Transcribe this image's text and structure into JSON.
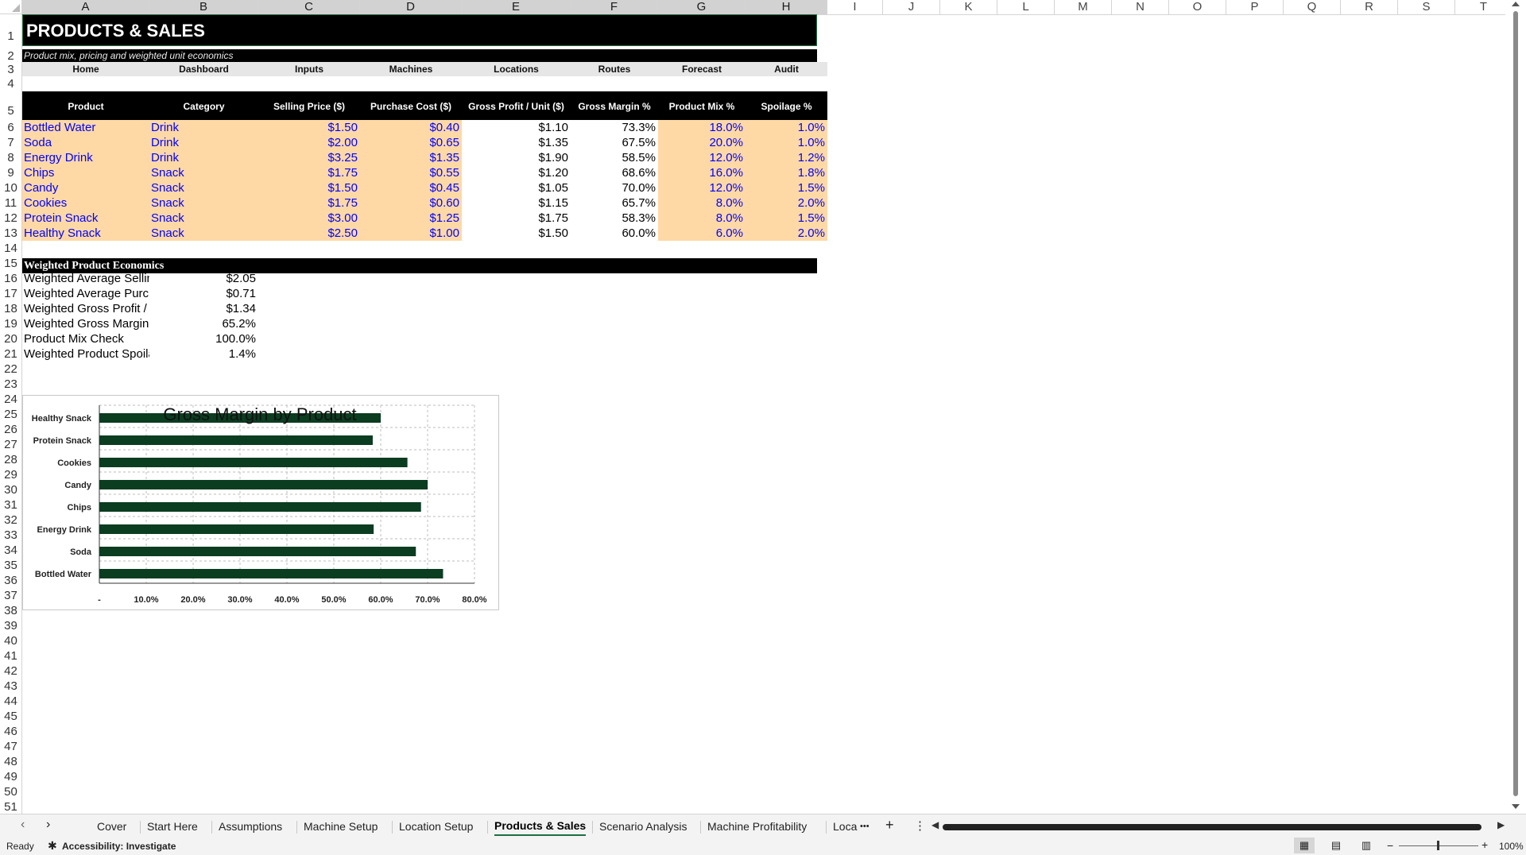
{
  "columns": [
    "A",
    "B",
    "C",
    "D",
    "E",
    "F",
    "G",
    "H",
    "I",
    "J",
    "K",
    "L",
    "M",
    "N",
    "O",
    "P",
    "Q",
    "R",
    "S",
    "T"
  ],
  "rows": [
    "1",
    "2",
    "3",
    "4",
    "5",
    "6",
    "7",
    "8",
    "9",
    "10",
    "11",
    "12",
    "13",
    "14",
    "15",
    "16",
    "17",
    "18",
    "19",
    "20",
    "21",
    "22",
    "23",
    "24",
    "25",
    "26",
    "27",
    "28",
    "29",
    "30",
    "31",
    "32",
    "33",
    "34",
    "35",
    "36",
    "37",
    "38",
    "39",
    "40",
    "41",
    "42",
    "43",
    "44",
    "45",
    "46",
    "47",
    "48",
    "49",
    "50",
    "51"
  ],
  "sheet": {
    "title": "PRODUCTS & SALES",
    "subtitle": "Product mix, pricing and weighted unit economics",
    "nav": [
      "Home",
      "Dashboard",
      "Inputs",
      "Machines",
      "Locations",
      "Routes",
      "Forecast",
      "Audit"
    ],
    "headers": [
      "Product",
      "Category",
      "Selling Price ($)",
      "Purchase Cost ($)",
      "Gross Profit / Unit ($)",
      "Gross Margin %",
      "Product Mix %",
      "Spoilage %"
    ],
    "products": [
      {
        "product": "Bottled Water",
        "category": "Drink",
        "price": "$1.50",
        "cost": "$0.40",
        "profit": "$1.10",
        "margin": "73.3%",
        "mix": "18.0%",
        "spoilage": "1.0%"
      },
      {
        "product": "Soda",
        "category": "Drink",
        "price": "$2.00",
        "cost": "$0.65",
        "profit": "$1.35",
        "margin": "67.5%",
        "mix": "20.0%",
        "spoilage": "1.0%"
      },
      {
        "product": "Energy Drink",
        "category": "Drink",
        "price": "$3.25",
        "cost": "$1.35",
        "profit": "$1.90",
        "margin": "58.5%",
        "mix": "12.0%",
        "spoilage": "1.2%"
      },
      {
        "product": "Chips",
        "category": "Snack",
        "price": "$1.75",
        "cost": "$0.55",
        "profit": "$1.20",
        "margin": "68.6%",
        "mix": "16.0%",
        "spoilage": "1.8%"
      },
      {
        "product": "Candy",
        "category": "Snack",
        "price": "$1.50",
        "cost": "$0.45",
        "profit": "$1.05",
        "margin": "70.0%",
        "mix": "12.0%",
        "spoilage": "1.5%"
      },
      {
        "product": "Cookies",
        "category": "Snack",
        "price": "$1.75",
        "cost": "$0.60",
        "profit": "$1.15",
        "margin": "65.7%",
        "mix": "8.0%",
        "spoilage": "2.0%"
      },
      {
        "product": "Protein Snack",
        "category": "Snack",
        "price": "$3.00",
        "cost": "$1.25",
        "profit": "$1.75",
        "margin": "58.3%",
        "mix": "8.0%",
        "spoilage": "1.5%"
      },
      {
        "product": "Healthy Snack",
        "category": "Snack",
        "price": "$2.50",
        "cost": "$1.00",
        "profit": "$1.50",
        "margin": "60.0%",
        "mix": "6.0%",
        "spoilage": "2.0%"
      }
    ],
    "weighted_title": "Weighted Product Economics",
    "weighted": [
      {
        "label": "Weighted Average Sellin",
        "value": "$2.05"
      },
      {
        "label": "Weighted Average Purcl",
        "value": "$0.71"
      },
      {
        "label": "Weighted Gross Profit /",
        "value": "$1.34"
      },
      {
        "label": "Weighted Gross Margin",
        "value": "65.2%"
      },
      {
        "label": "Product Mix Check",
        "value": "100.0%"
      },
      {
        "label": "Weighted Product Spoila",
        "value": "1.4%"
      }
    ]
  },
  "chart_data": {
    "type": "bar",
    "orientation": "horizontal",
    "title": "Gross Margin by Product",
    "categories": [
      "Healthy Snack",
      "Protein Snack",
      "Cookies",
      "Candy",
      "Chips",
      "Energy Drink",
      "Soda",
      "Bottled Water"
    ],
    "values": [
      0.6,
      0.583,
      0.657,
      0.7,
      0.686,
      0.585,
      0.675,
      0.733
    ],
    "xlim": [
      0,
      0.8
    ],
    "xticks": [
      "-",
      "10.0%",
      "20.0%",
      "30.0%",
      "40.0%",
      "50.0%",
      "60.0%",
      "70.0%",
      "80.0%"
    ],
    "bar_color": "#0b3d20",
    "grid": true,
    "legend": "none"
  },
  "tabs": {
    "items": [
      "Cover",
      "Start Here",
      "Assumptions",
      "Machine Setup",
      "Location Setup",
      "Products & Sales",
      "Scenario Analysis",
      "Machine Profitability",
      "Loca"
    ],
    "active": "Products & Sales",
    "more": "•••",
    "add": "+",
    "menu": "⋮"
  },
  "status": {
    "ready": "Ready",
    "accessibility": "Accessibility: Investigate",
    "zoom": "100%"
  }
}
